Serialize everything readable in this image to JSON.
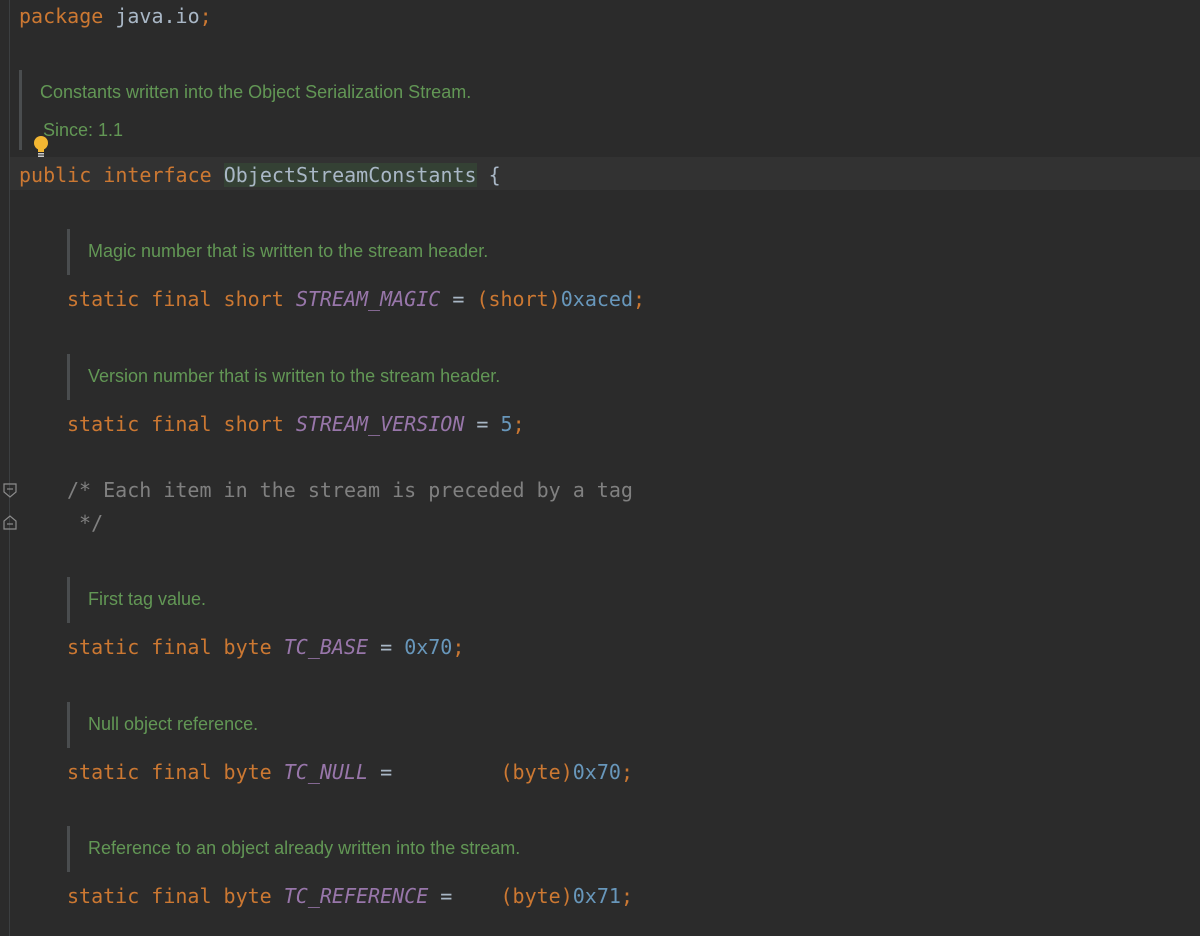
{
  "package_line": {
    "keyword": "package",
    "name": "java.io",
    "semicolon": ";"
  },
  "class_doc": {
    "text": "Constants written into the Object Serialization Stream.",
    "since": "Since: 1.1"
  },
  "class_decl": {
    "modifier": "public",
    "keyword": "interface",
    "name": "ObjectStreamConstants",
    "brace": "{"
  },
  "comment_block": {
    "line1": "/* Each item in the stream is preceded by a tag",
    "line2": " */"
  },
  "fields": [
    {
      "doc": "Magic number that is written to the stream header.",
      "modifiers": "static final",
      "type": "short",
      "name": "STREAM_MAGIC",
      "eq": " = ",
      "cast": "(short)",
      "value": "0xaced",
      "semicolon": ";"
    },
    {
      "doc": "Version number that is written to the stream header.",
      "modifiers": "static final",
      "type": "short",
      "name": "STREAM_VERSION",
      "eq": " = ",
      "cast": "",
      "value": "5",
      "semicolon": ";"
    },
    {
      "doc": "First tag value.",
      "modifiers": "static final",
      "type": "byte",
      "name": "TC_BASE",
      "eq": " = ",
      "cast": "",
      "value": "0x70",
      "semicolon": ";"
    },
    {
      "doc": "Null object reference.",
      "modifiers": "static final",
      "type": "byte",
      "name": "TC_NULL",
      "eq": " =         ",
      "cast": "(byte)",
      "value": "0x70",
      "semicolon": ";"
    },
    {
      "doc": "Reference to an object already written into the stream.",
      "modifiers": "static final",
      "type": "byte",
      "name": "TC_REFERENCE",
      "eq": " =    ",
      "cast": "(byte)",
      "value": "0x71",
      "semicolon": ";"
    }
  ],
  "colors": {
    "background": "#2b2b2b",
    "keyword": "#cc7832",
    "plain": "#a9b7c6",
    "constant": "#9876aa",
    "number": "#6897bb",
    "doc_comment": "#629755",
    "block_comment": "#808080"
  },
  "icons": [
    "intention-bulb-icon",
    "fold-start-icon",
    "fold-end-icon"
  ]
}
